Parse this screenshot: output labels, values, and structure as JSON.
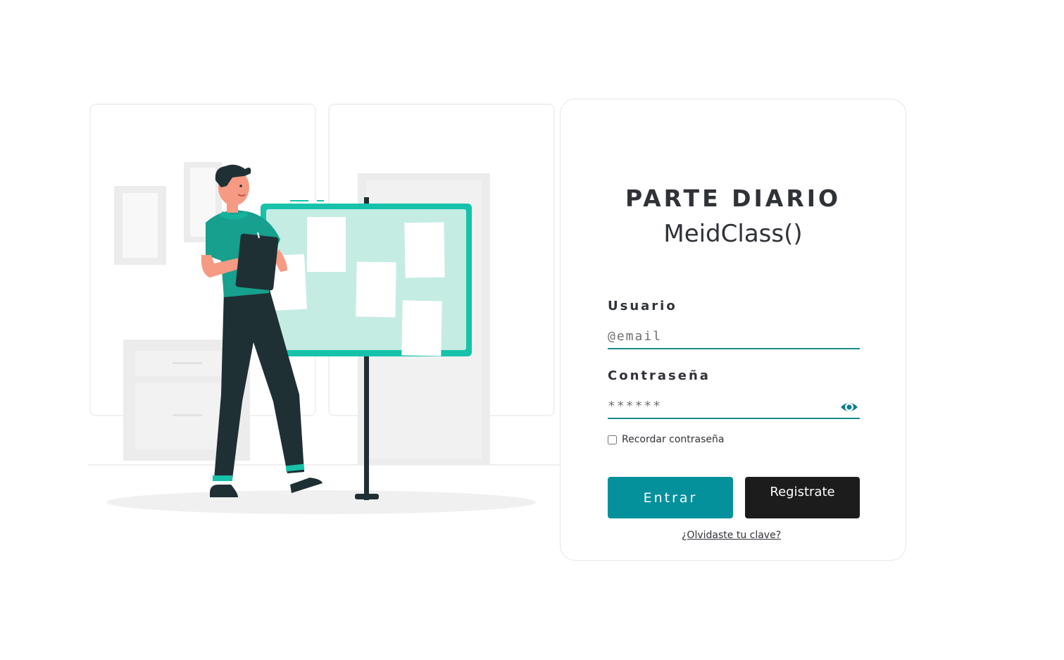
{
  "app": {
    "title": "PARTE DIARIO",
    "subtitle": "MeidClass()"
  },
  "form": {
    "username_label": "Usuario",
    "username_placeholder": "@email",
    "password_label": "Contraseña",
    "password_placeholder": "******",
    "remember_label": "Recordar contraseña",
    "login_label": "Entrar",
    "register_label": "Registrate",
    "forgot_label": "¿Olvidaste tu clave?",
    "show_password_icon": "eye-icon"
  },
  "colors": {
    "accent": "#05919c",
    "field_underline": "#1c8a8a",
    "dark_button": "#1c1c1c",
    "text": "#2f3237"
  }
}
